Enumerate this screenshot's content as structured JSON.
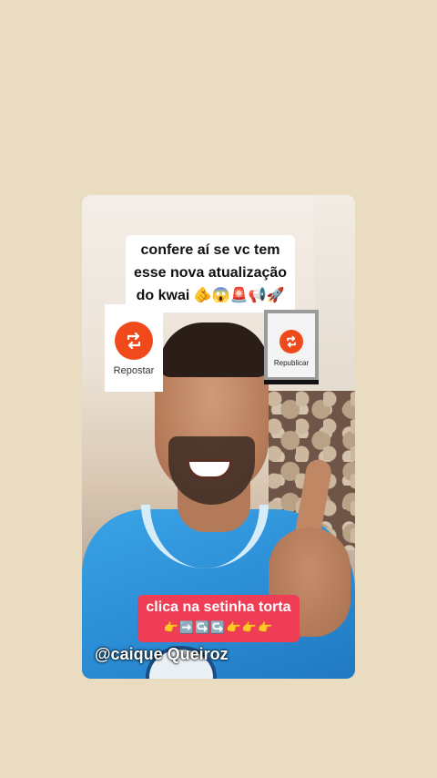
{
  "caption": {
    "lines": [
      "confere aí se vc tem",
      "esse nova atualização",
      "do kwai 🫵😱🚨📢🚀"
    ]
  },
  "repost_button": {
    "label": "Repostar",
    "icon": "repost-icon",
    "color": "#f04a1c"
  },
  "republish_button": {
    "label": "Republicar",
    "icon": "repost-icon",
    "color": "#f04a1c"
  },
  "cta": {
    "text": "clica na setinha torta",
    "emojis": "👉➡️↪️↪️👉👉👉",
    "color": "#ef3d55"
  },
  "creator": {
    "handle": "@caique Queiroz"
  },
  "colors": {
    "background": "#e9dcc1"
  }
}
